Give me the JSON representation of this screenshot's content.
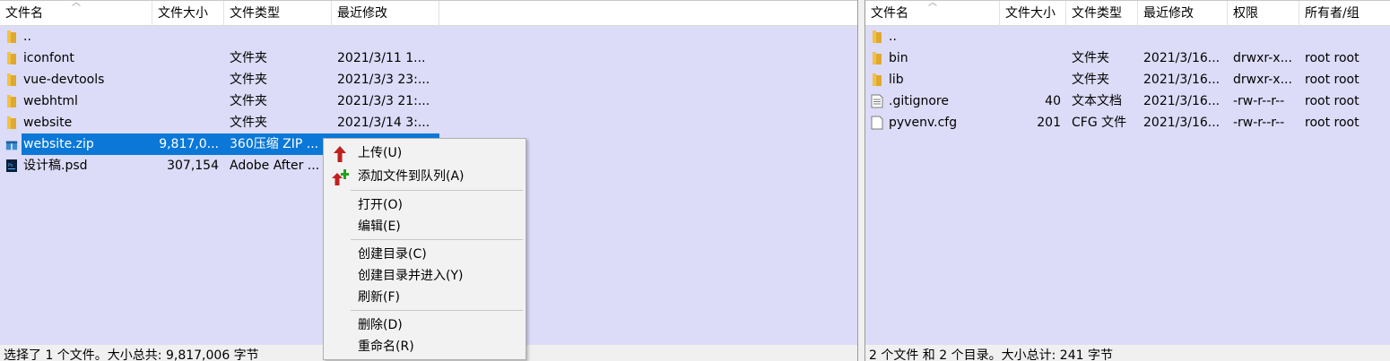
{
  "local": {
    "columns": [
      "文件名",
      "文件大小",
      "文件类型",
      "最近修改"
    ],
    "rows": [
      {
        "name": "..",
        "size": "",
        "type": "",
        "modified": "",
        "icon": "folder-icon"
      },
      {
        "name": "iconfont",
        "size": "",
        "type": "文件夹",
        "modified": "2021/3/11 1...",
        "icon": "folder-icon"
      },
      {
        "name": "vue-devtools",
        "size": "",
        "type": "文件夹",
        "modified": "2021/3/3 23:...",
        "icon": "folder-icon"
      },
      {
        "name": "webhtml",
        "size": "",
        "type": "文件夹",
        "modified": "2021/3/3 21:...",
        "icon": "folder-icon"
      },
      {
        "name": "website",
        "size": "",
        "type": "文件夹",
        "modified": "2021/3/14 3:...",
        "icon": "folder-icon"
      },
      {
        "name": "website.zip",
        "size": "9,817,0...",
        "type": "360压缩 ZIP ...",
        "modified": "",
        "icon": "zip-archive-icon"
      },
      {
        "name": "设计稿.psd",
        "size": "307,154",
        "type": "Adobe After ...",
        "modified": "",
        "icon": "psd-file-icon"
      }
    ],
    "status": "选择了 1 个文件。大小总共: 9,817,006 字节"
  },
  "remote": {
    "columns": [
      "文件名",
      "文件大小",
      "文件类型",
      "最近修改",
      "权限",
      "所有者/组"
    ],
    "rows": [
      {
        "name": "..",
        "size": "",
        "type": "",
        "modified": "",
        "perm": "",
        "owner": "",
        "icon": "folder-icon"
      },
      {
        "name": "bin",
        "size": "",
        "type": "文件夹",
        "modified": "2021/3/16...",
        "perm": "drwxr-x...",
        "owner": "root root",
        "icon": "folder-icon"
      },
      {
        "name": "lib",
        "size": "",
        "type": "文件夹",
        "modified": "2021/3/16...",
        "perm": "drwxr-x...",
        "owner": "root root",
        "icon": "folder-icon"
      },
      {
        "name": ".gitignore",
        "size": "40",
        "type": "文本文档",
        "modified": "2021/3/16...",
        "perm": "-rw-r--r--",
        "owner": "root root",
        "icon": "text-file-icon"
      },
      {
        "name": "pyvenv.cfg",
        "size": "201",
        "type": "CFG 文件",
        "modified": "2021/3/16...",
        "perm": "-rw-r--r--",
        "owner": "root root",
        "icon": "blank-file-icon"
      }
    ],
    "status": "2 个文件 和 2 个目录。大小总计: 241 字节"
  },
  "context_menu": {
    "items": [
      {
        "label": "上传(U)",
        "icon": "upload-arrow-icon"
      },
      {
        "label": "添加文件到队列(A)",
        "icon": "add-to-queue-icon"
      },
      {
        "label": "打开(O)",
        "icon": ""
      },
      {
        "label": "编辑(E)",
        "icon": ""
      },
      {
        "label": "创建目录(C)",
        "icon": ""
      },
      {
        "label": "创建目录并进入(Y)",
        "icon": ""
      },
      {
        "label": "刷新(F)",
        "icon": ""
      },
      {
        "label": "删除(D)",
        "icon": ""
      },
      {
        "label": "重命名(R)",
        "icon": ""
      }
    ]
  },
  "colors": {
    "list_bg": "#dcdcf8",
    "selection": "#0b78d7",
    "folder": "#f2c146",
    "upload_arrow": "#c0211e",
    "plus": "#23a11f"
  }
}
